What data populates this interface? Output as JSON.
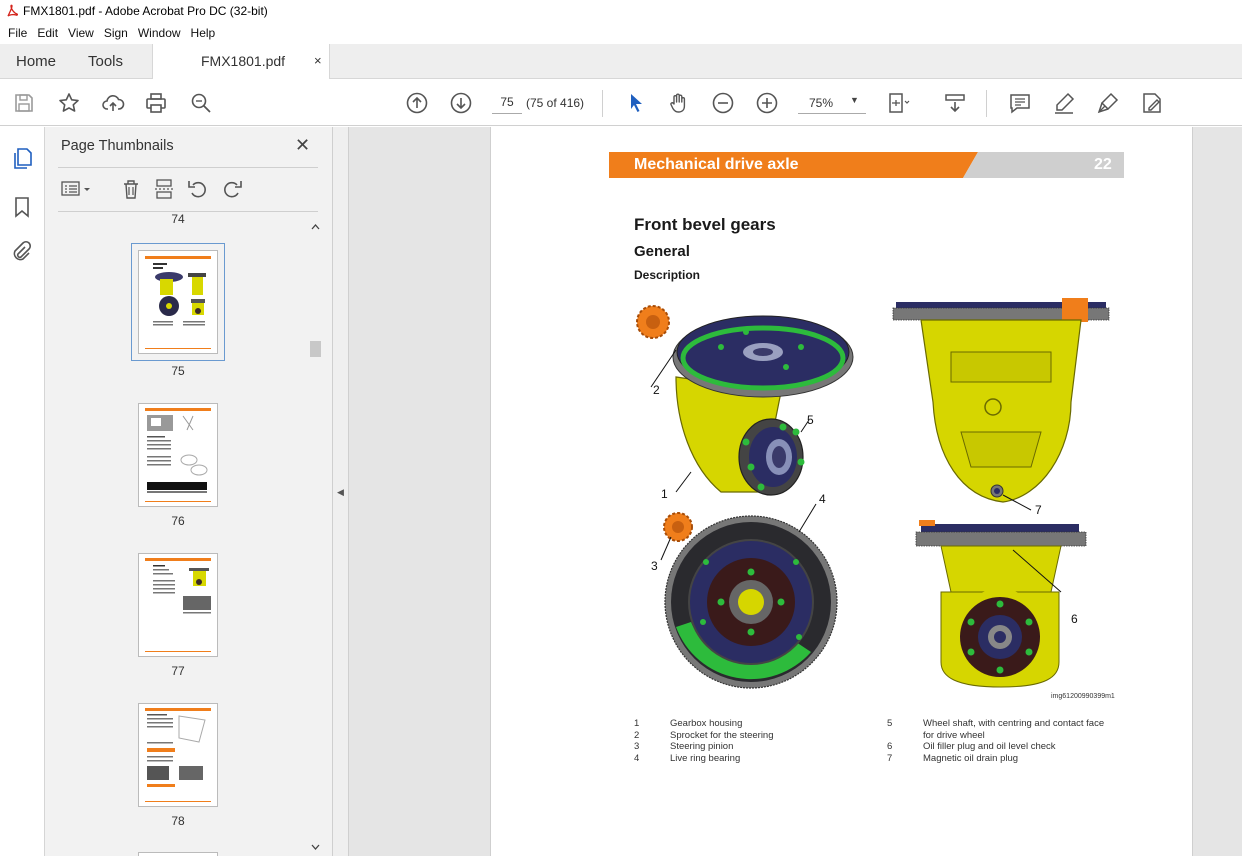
{
  "window": {
    "title": "FMX1801.pdf - Adobe Acrobat Pro DC (32-bit)"
  },
  "menu": [
    "File",
    "Edit",
    "View",
    "Sign",
    "Window",
    "Help"
  ],
  "tabs": {
    "home": "Home",
    "tools": "Tools",
    "document": "FMX1801.pdf",
    "close": "×"
  },
  "toolbar": {
    "page_current": "75",
    "page_count": "(75 of 416)",
    "zoom": "75%"
  },
  "sidebar": {
    "panel_title": "Page Thumbnails",
    "close": "✕",
    "thumbnails": [
      {
        "label": "74"
      },
      {
        "label": "75",
        "selected": true
      },
      {
        "label": "76"
      },
      {
        "label": "77"
      },
      {
        "label": "78"
      }
    ]
  },
  "colors": {
    "accent_orange": "#f07e1b",
    "banner_gray": "#cfcfcf",
    "selection": "#6a9ad0"
  },
  "document": {
    "banner_title": "Mechanical drive axle",
    "banner_number": "22",
    "heading": "Front bevel gears",
    "subheading": "General",
    "section": "Description",
    "image_code": "img61200990399m1",
    "callouts": [
      "1",
      "2",
      "3",
      "4",
      "5",
      "6",
      "7"
    ],
    "legend_left": [
      {
        "n": "1",
        "text": "Gearbox housing"
      },
      {
        "n": "2",
        "text": "Sprocket for the steering"
      },
      {
        "n": "3",
        "text": "Steering pinion"
      },
      {
        "n": "4",
        "text": "Live ring bearing"
      }
    ],
    "legend_right": [
      {
        "n": "5",
        "text": "Wheel shaft, with centring and contact face",
        "text2": "for drive wheel"
      },
      {
        "n": "6",
        "text": "Oil filler plug and oil level check"
      },
      {
        "n": "7",
        "text": "Magnetic oil drain plug"
      }
    ]
  }
}
